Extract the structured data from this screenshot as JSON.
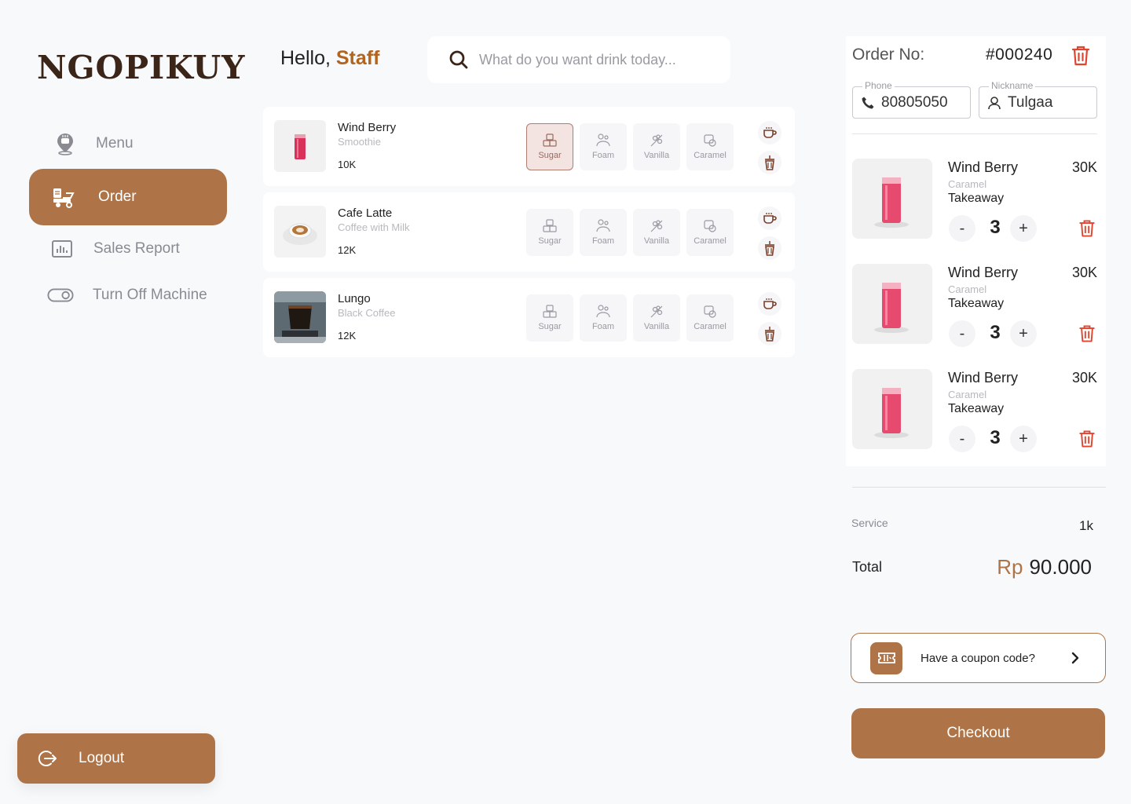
{
  "brand": {
    "logo": "NGOPIKUY"
  },
  "sidebar": {
    "items": [
      {
        "label": "Menu",
        "icon": "coffee-map-pin-icon",
        "active": false
      },
      {
        "label": "Order",
        "icon": "delivery-cart-icon",
        "active": true
      },
      {
        "label": "Sales Report",
        "icon": "bar-chart-icon",
        "active": false
      },
      {
        "label": "Turn Off Machine",
        "icon": "toggle-icon",
        "active": false
      }
    ],
    "logout_label": "Logout"
  },
  "header": {
    "greeting": "Hello,",
    "user": "Staff",
    "search_placeholder": "What do you want drink today..."
  },
  "addons": [
    "Sugar",
    "Foam",
    "Vanilla",
    "Caramel"
  ],
  "products": [
    {
      "name": "Wind Berry",
      "subtitle": "Smoothie",
      "price": "10K",
      "image": "pink-smoothie",
      "selected_addon": "Sugar"
    },
    {
      "name": "Cafe Latte",
      "subtitle": "Coffee with Milk",
      "price": "12K",
      "image": "latte-art-cup",
      "selected_addon": null
    },
    {
      "name": "Lungo",
      "subtitle": "Black Coffee",
      "price": "12K",
      "image": "espresso-glass",
      "selected_addon": null
    }
  ],
  "order": {
    "label": "Order No:",
    "number": "#000240",
    "phone_label": "Phone",
    "phone": "80805050",
    "nickname_label": "Nickname",
    "nickname": "Tulgaa",
    "items": [
      {
        "name": "Wind Berry",
        "variant": "Caramel",
        "type": "Takeaway",
        "price": "30K",
        "qty": "3"
      },
      {
        "name": "Wind Berry",
        "variant": "Caramel",
        "type": "Takeaway",
        "price": "30K",
        "qty": "3"
      },
      {
        "name": "Wind Berry",
        "variant": "Caramel",
        "type": "Takeaway",
        "price": "30K",
        "qty": "3"
      }
    ],
    "minus": "-",
    "plus": "+"
  },
  "summary": {
    "service_label": "Service",
    "service_value": "1k",
    "total_label": "Total",
    "currency": "Rp",
    "total_value": "90.000"
  },
  "coupon": {
    "label": "Have a coupon code?"
  },
  "checkout_label": "Checkout",
  "colors": {
    "accent": "#ae7447",
    "brand_dark": "#3b2418",
    "staff_highlight": "#b1651f",
    "danger": "#e0452f"
  }
}
